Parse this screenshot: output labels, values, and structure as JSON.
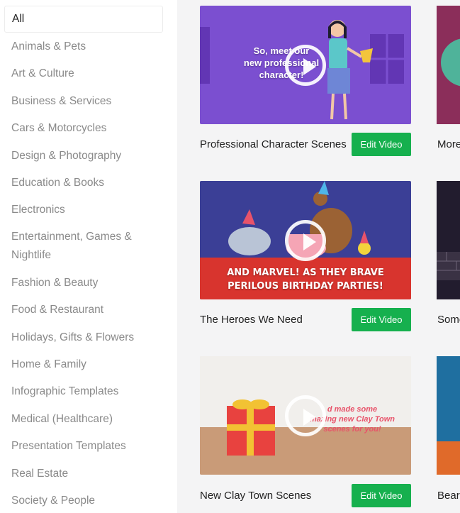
{
  "sidebar": {
    "categories": [
      "All",
      "Animals & Pets",
      "Art & Culture",
      "Business & Services",
      "Cars & Motorcycles",
      "Design & Photography",
      "Education & Books",
      "Electronics",
      "Entertainment, Games &",
      "Nightlife",
      "Fashion & Beauty",
      "Food & Restaurant",
      "Holidays, Gifts & Flowers",
      "Home & Family",
      "Infographic Templates",
      "Medical (Healthcare)",
      "Presentation Templates",
      "Real Estate",
      "Society & People"
    ],
    "active": "All"
  },
  "cards": [
    {
      "title": "Professional Character Scenes",
      "button": "Edit Video",
      "overlay": [
        "So, meet our",
        "new professional",
        "character!"
      ]
    },
    {
      "title": "The Heroes We Need",
      "button": "Edit Video",
      "overlay": [
        "AND MARVEL! AS THEY BRAVE",
        "PERILOUS BIRTHDAY PARTIES!"
      ]
    },
    {
      "title": "New Clay Town Scenes",
      "button": "Edit Video",
      "overlay": [
        "d made some",
        "mazing new Clay Town",
        "scenes for you!"
      ]
    }
  ],
  "partial_cards": [
    {
      "title": "More"
    },
    {
      "title": "Some"
    },
    {
      "title": "Bear"
    }
  ],
  "colors": {
    "accent_button": "#16b04e",
    "card1_bg": "#7b4fd0",
    "card2_bg": "#3b3f96",
    "card3_bg": "#e9e6e1"
  }
}
